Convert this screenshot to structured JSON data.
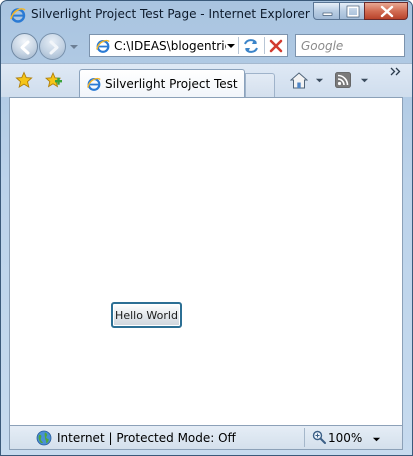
{
  "window": {
    "title": "Silverlight Project Test Page - Internet Explorer pro..."
  },
  "address_bar": {
    "url": "C:\\IDEAS\\blogentrie"
  },
  "search": {
    "placeholder": "Google"
  },
  "tabs": [
    {
      "label": "Silverlight Project Test P..."
    }
  ],
  "page": {
    "button_label": "Hello World"
  },
  "status_bar": {
    "zone": "Internet | Protected Mode: Off",
    "zoom": "100%"
  },
  "icons": {
    "browser": "internet-explorer-icon",
    "favorites": "star-icon",
    "add_favorites": "add-favorite-icon",
    "home": "home-icon",
    "feeds": "rss-feed-icon",
    "zone": "globe-icon",
    "zoom": "magnifier-icon"
  },
  "colors": {
    "chrome": "#bcd3ea",
    "close_button": "#c9553c",
    "stop_icon": "#d23b2f",
    "feed_icon": "#7a7a7a",
    "accent": "#2c6f94"
  }
}
